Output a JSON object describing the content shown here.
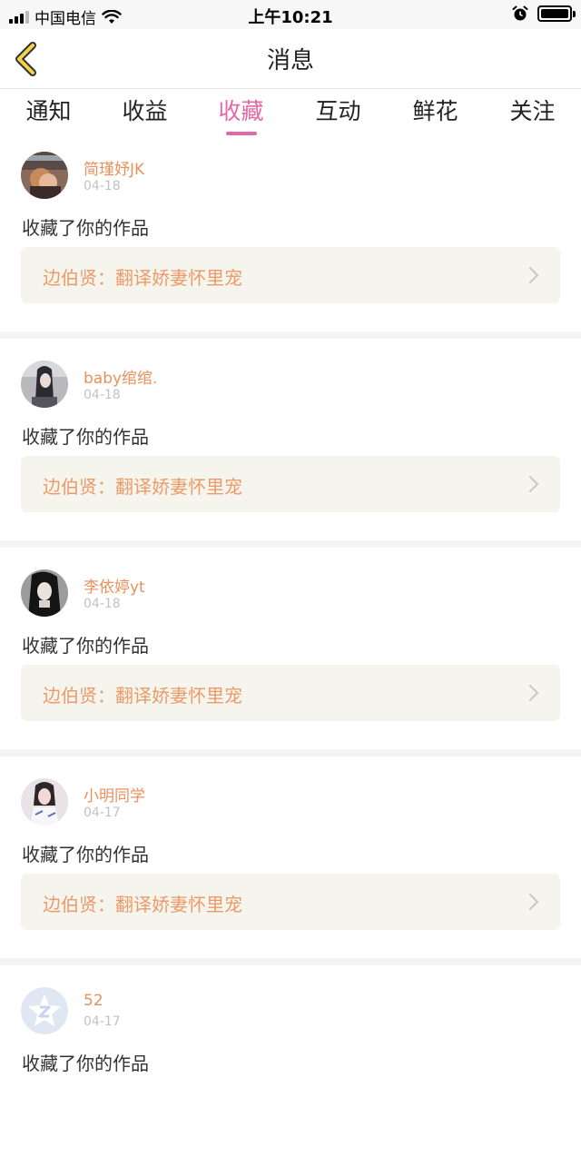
{
  "status_bar": {
    "carrier": "中国电信",
    "time": "上午10:21"
  },
  "header": {
    "title": "消息"
  },
  "tabs": [
    {
      "label": "通知",
      "active": false
    },
    {
      "label": "收益",
      "active": false
    },
    {
      "label": "收藏",
      "active": true
    },
    {
      "label": "互动",
      "active": false
    },
    {
      "label": "鲜花",
      "active": false
    },
    {
      "label": "关注",
      "active": false
    }
  ],
  "messages": [
    {
      "user": "简瑾妤JK",
      "date": "04-18",
      "action": "收藏了你的作品",
      "work": "边伯贤：翻译娇妻怀里宠"
    },
    {
      "user": "baby绾绾.",
      "date": "04-18",
      "action": "收藏了你的作品",
      "work": "边伯贤：翻译娇妻怀里宠"
    },
    {
      "user": "李依婷yt",
      "date": "04-18",
      "action": "收藏了你的作品",
      "work": "边伯贤：翻译娇妻怀里宠"
    },
    {
      "user": "小明同学",
      "date": "04-17",
      "action": "收藏了你的作品",
      "work": "边伯贤：翻译娇妻怀里宠"
    },
    {
      "user": "52",
      "date": "04-17",
      "action": "收藏了你的作品",
      "work": ""
    }
  ],
  "colors": {
    "accent": "#e667a8",
    "username": "#e8915d",
    "work_title": "#ec9a69",
    "work_bg": "#f5f5ee"
  }
}
